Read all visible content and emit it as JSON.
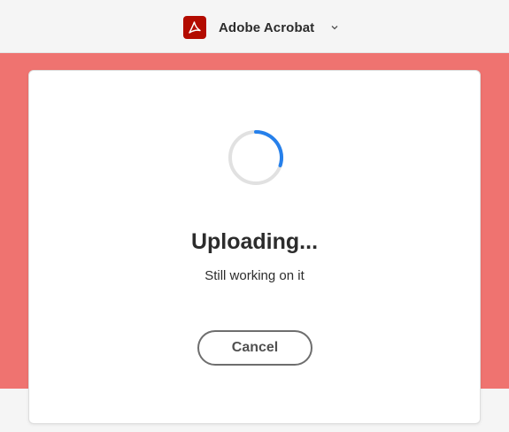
{
  "header": {
    "app_name": "Adobe Acrobat",
    "logo_icon": "acrobat-logo-icon",
    "dropdown_icon": "chevron-down-icon"
  },
  "dialog": {
    "title": "Uploading...",
    "subtitle": "Still working on it",
    "cancel_label": "Cancel",
    "spinner_icon": "loading-spinner-icon"
  },
  "colors": {
    "background_band": "#ef7370",
    "brand_red": "#b30b00",
    "spinner_accent": "#2680eb",
    "spinner_track": "#e1e1e1"
  }
}
